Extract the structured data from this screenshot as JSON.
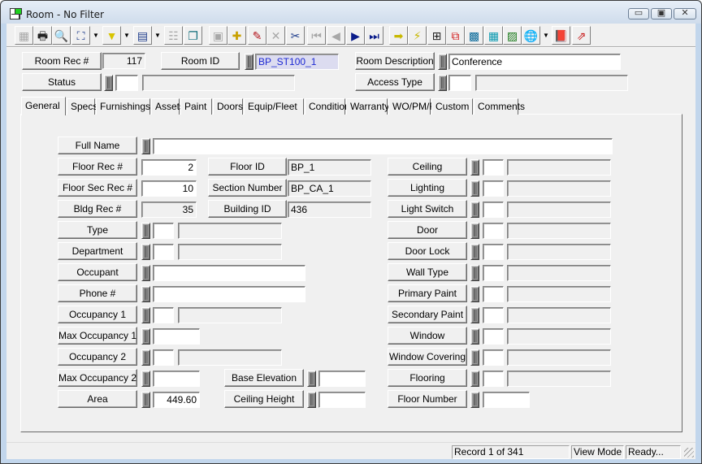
{
  "window": {
    "title": "Room - No Filter",
    "controls": {
      "minimize": "▭",
      "maximize": "▣",
      "close": "✕"
    }
  },
  "toolbar": {
    "buttons": [
      {
        "name": "blank-form",
        "icon": "▦",
        "enabled": false
      },
      {
        "name": "print",
        "icon": "🖶",
        "enabled": true
      },
      {
        "name": "print-preview",
        "icon": "🔍",
        "enabled": true
      },
      {
        "name": "find",
        "icon": "⛶",
        "enabled": true,
        "dropdown": true
      },
      {
        "name": "filter",
        "icon": "▼",
        "enabled": true,
        "dropdown": true
      },
      {
        "name": "report",
        "icon": "▤",
        "enabled": true,
        "dropdown": true
      },
      {
        "name": "properties",
        "icon": "☷",
        "enabled": false
      },
      {
        "name": "copy-record",
        "icon": "❐",
        "enabled": true
      },
      {
        "name": "save",
        "icon": "▣",
        "enabled": false
      },
      {
        "name": "add-record",
        "icon": "✚",
        "enabled": true
      },
      {
        "name": "edit",
        "icon": "✎",
        "enabled": true
      },
      {
        "name": "delete",
        "icon": "✕",
        "enabled": false
      },
      {
        "name": "cut",
        "icon": "✂",
        "enabled": true
      },
      {
        "name": "first-record",
        "icon": "⏮",
        "enabled": false
      },
      {
        "name": "previous-record",
        "icon": "◀",
        "enabled": false
      },
      {
        "name": "next-record",
        "icon": "▶",
        "enabled": true
      },
      {
        "name": "last-record",
        "icon": "⏭",
        "enabled": true
      },
      {
        "name": "go-to",
        "icon": "➡",
        "enabled": true
      },
      {
        "name": "quick-action",
        "icon": "⚡",
        "enabled": true
      },
      {
        "name": "hierarchy",
        "icon": "⊞",
        "enabled": true
      },
      {
        "name": "flow",
        "icon": "⧉",
        "enabled": true
      },
      {
        "name": "equipment",
        "icon": "▩",
        "enabled": true
      },
      {
        "name": "calculator",
        "icon": "▦",
        "enabled": true
      },
      {
        "name": "map-image",
        "icon": "▨",
        "enabled": true
      },
      {
        "name": "globe-search",
        "icon": "🌐",
        "enabled": true,
        "dropdown": true
      },
      {
        "name": "help-book",
        "icon": "📕",
        "enabled": true
      },
      {
        "name": "exit",
        "icon": "⇗",
        "enabled": true
      }
    ]
  },
  "header": {
    "room_rec_label": "Room Rec #",
    "room_rec_value": "117",
    "room_id_label": "Room ID",
    "room_id_value": "BP_ST100_1",
    "room_description_label": "Room Description",
    "room_description_value": "Conference",
    "status_label": "Status",
    "status_code": "",
    "status_desc": "",
    "access_type_label": "Access Type",
    "access_type_code": "",
    "access_type_desc": ""
  },
  "tabs": [
    {
      "label": "General",
      "active": true
    },
    {
      "label": "Specs"
    },
    {
      "label": "Furnishings"
    },
    {
      "label": "Assets"
    },
    {
      "label": "Paint"
    },
    {
      "label": "Doors"
    },
    {
      "label": "Equip/Fleet"
    },
    {
      "label": "Condition"
    },
    {
      "label": "Warranty"
    },
    {
      "label": "WO/PM/Req"
    },
    {
      "label": "Custom"
    },
    {
      "label": "Comments"
    }
  ],
  "general": {
    "full_name": {
      "label": "Full Name",
      "value": ""
    },
    "floor_rec": {
      "label": "Floor Rec #",
      "value": "2"
    },
    "floor_sec_rec": {
      "label": "Floor Sec Rec #",
      "value": "10"
    },
    "bldg_rec": {
      "label": "Bldg Rec #",
      "value": "35"
    },
    "floor_id": {
      "label": "Floor ID",
      "value": "BP_1"
    },
    "section_number": {
      "label": "Section Number",
      "value": "BP_CA_1"
    },
    "building_id": {
      "label": "Building ID",
      "value": "436"
    },
    "type": {
      "label": "Type",
      "code": "",
      "desc": ""
    },
    "department": {
      "label": "Department",
      "code": "",
      "desc": ""
    },
    "occupant": {
      "label": "Occupant",
      "value": ""
    },
    "phone": {
      "label": "Phone #",
      "value": ""
    },
    "occupancy1": {
      "label": "Occupancy 1",
      "code": "",
      "desc": ""
    },
    "max_occupancy1": {
      "label": "Max Occupancy 1",
      "value": ""
    },
    "occupancy2": {
      "label": "Occupancy 2",
      "code": "",
      "desc": ""
    },
    "max_occupancy2": {
      "label": "Max Occupancy 2",
      "value": ""
    },
    "area": {
      "label": "Area",
      "value": "449.60"
    },
    "base_elevation": {
      "label": "Base Elevation",
      "value": ""
    },
    "ceiling_height": {
      "label": "Ceiling Height",
      "value": ""
    },
    "right": [
      {
        "key": "ceiling",
        "label": "Ceiling",
        "code": "",
        "desc": ""
      },
      {
        "key": "lighting",
        "label": "Lighting",
        "code": "",
        "desc": ""
      },
      {
        "key": "light-switch",
        "label": "Light Switch",
        "code": "",
        "desc": ""
      },
      {
        "key": "door",
        "label": "Door",
        "code": "",
        "desc": ""
      },
      {
        "key": "door-lock",
        "label": "Door Lock",
        "code": "",
        "desc": ""
      },
      {
        "key": "wall-type",
        "label": "Wall Type",
        "code": "",
        "desc": ""
      },
      {
        "key": "primary-paint",
        "label": "Primary Paint",
        "code": "",
        "desc": ""
      },
      {
        "key": "secondary-paint",
        "label": "Secondary Paint",
        "code": "",
        "desc": ""
      },
      {
        "key": "window",
        "label": "Window",
        "code": "",
        "desc": ""
      },
      {
        "key": "window-covering",
        "label": "Window Covering",
        "code": "",
        "desc": ""
      },
      {
        "key": "flooring",
        "label": "Flooring",
        "code": "",
        "desc": ""
      }
    ],
    "floor_number": {
      "label": "Floor Number",
      "value": ""
    }
  },
  "status_bar": {
    "record": "Record 1 of 341",
    "mode": "View Mode",
    "state": "Ready..."
  }
}
